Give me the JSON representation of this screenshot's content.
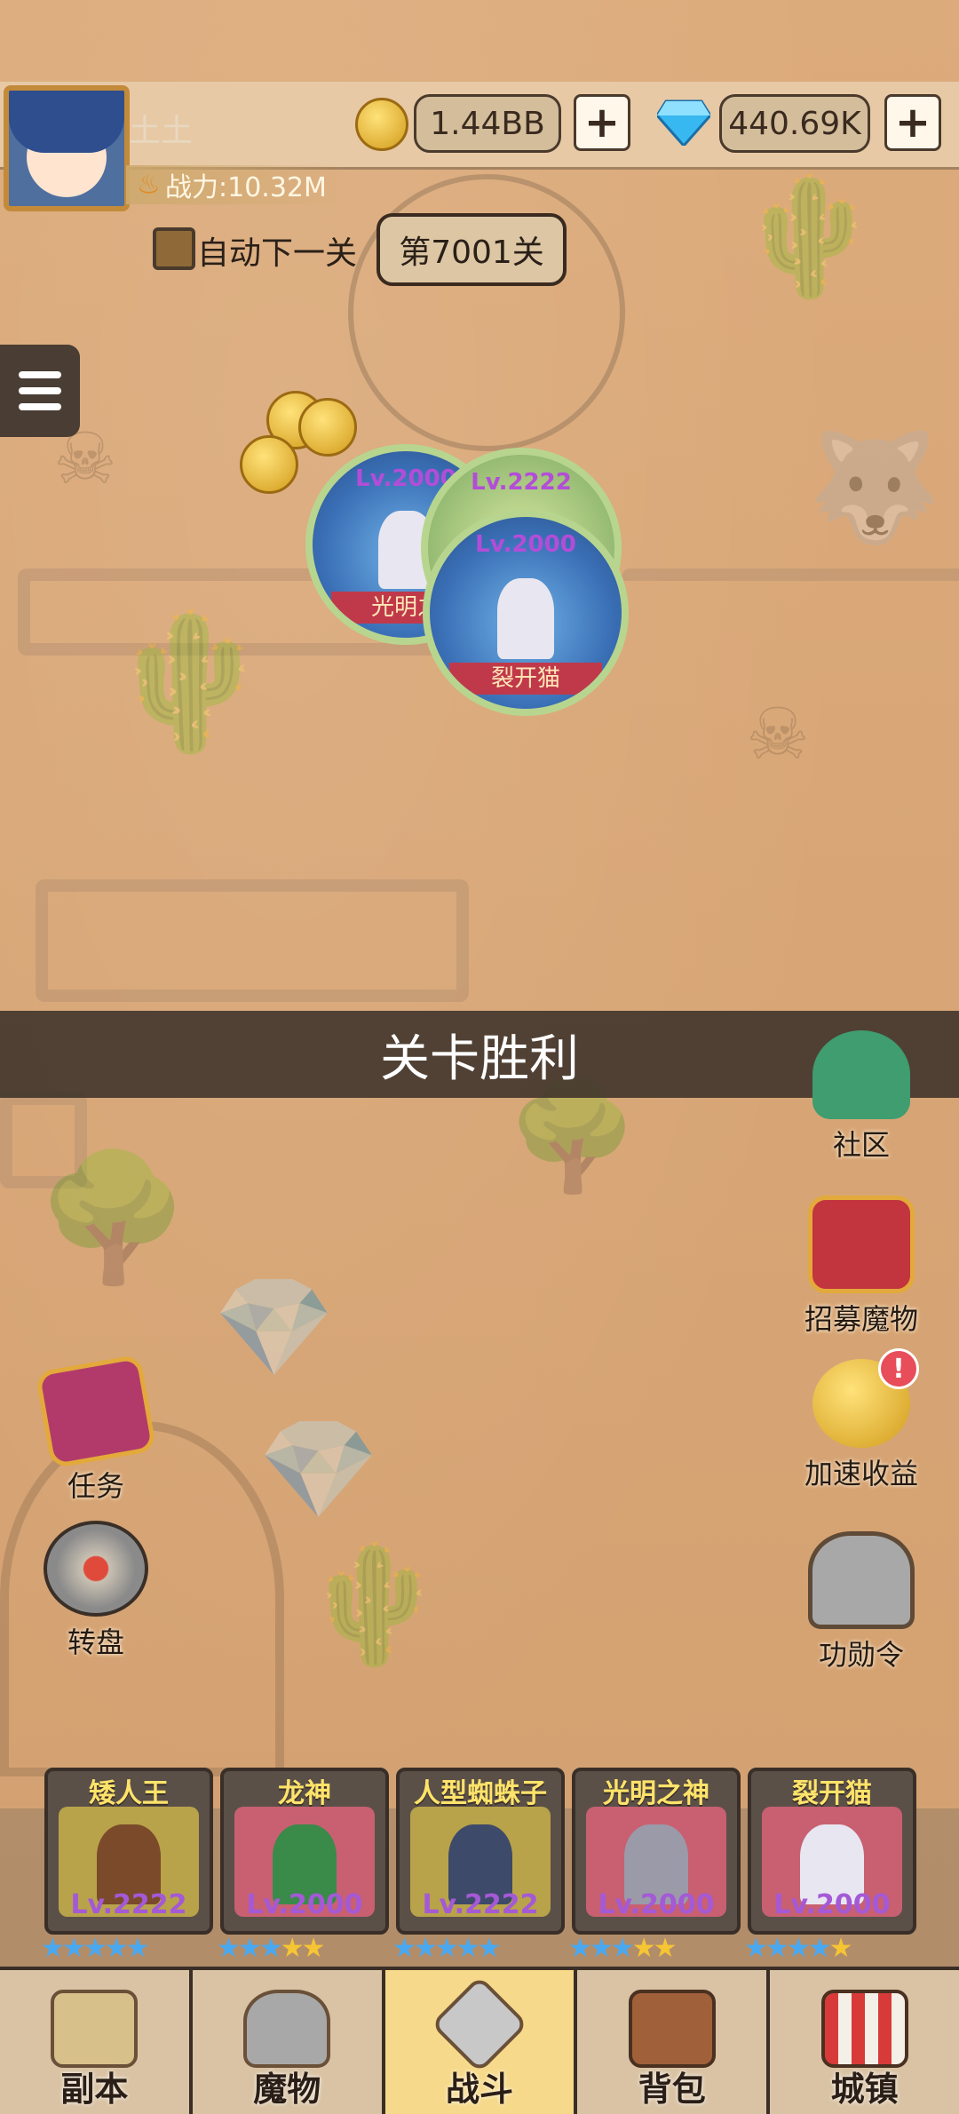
{
  "player": {
    "name": "土土",
    "power": "战力:10.32M"
  },
  "currency": {
    "gold": "1.44BB",
    "gems": "440.69K",
    "plus": "+"
  },
  "stage": {
    "auto_label": "自动下一关",
    "current": "第7001关"
  },
  "map_heroes": [
    {
      "level": "Lv.2000",
      "name": "光明之"
    },
    {
      "level": "Lv.2222",
      "name": ""
    },
    {
      "level": "Lv.2000",
      "name": "裂开猫"
    }
  ],
  "banner": "关卡胜利",
  "right_buttons": [
    {
      "label": "社区",
      "icon": "tap-icon"
    },
    {
      "label": "招募魔物",
      "icon": "helmet-banner-icon"
    },
    {
      "label": "加速收益",
      "icon": "gold-coin-arrow-icon",
      "badge": "!"
    },
    {
      "label": "功勋令",
      "icon": "knight-helmet-icon"
    }
  ],
  "left_buttons": [
    {
      "label": "任务",
      "icon": "book-icon"
    },
    {
      "label": "转盘",
      "icon": "wheel-icon"
    }
  ],
  "team": [
    {
      "name": "矮人王",
      "level": "Lv.2222",
      "stars_blue": 5,
      "stars_gold": 0
    },
    {
      "name": "龙神",
      "level": "Lv.2000",
      "stars_blue": 3,
      "stars_gold": 2
    },
    {
      "name": "人型蜘蛛子",
      "level": "Lv.2222",
      "stars_blue": 5,
      "stars_gold": 0
    },
    {
      "name": "光明之神",
      "level": "Lv.2000",
      "stars_blue": 3,
      "stars_gold": 2
    },
    {
      "name": "裂开猫",
      "level": "Lv.2000",
      "stars_blue": 4,
      "stars_gold": 1
    }
  ],
  "nav": [
    {
      "label": "副本",
      "icon": "map-icon"
    },
    {
      "label": "魔物",
      "icon": "helmet-icon"
    },
    {
      "label": "战斗",
      "icon": "crossed-swords-icon",
      "active": true
    },
    {
      "label": "背包",
      "icon": "backpack-icon"
    },
    {
      "label": "城镇",
      "icon": "shop-icon"
    }
  ]
}
